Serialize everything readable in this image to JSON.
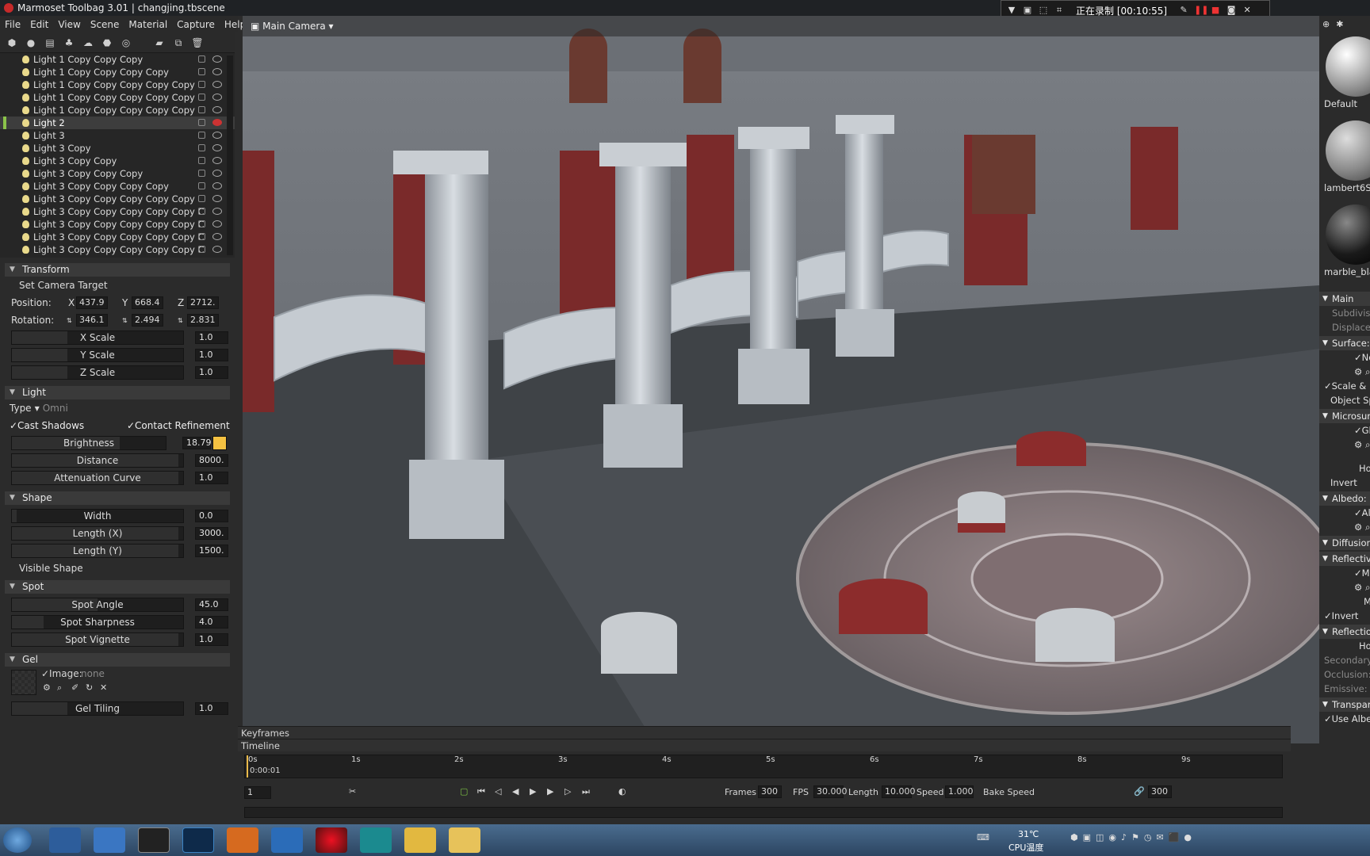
{
  "window": {
    "title": "Marmoset Toolbag 3.01  |  changjing.tbscene"
  },
  "recorder": {
    "status": "正在录制 [00:10:55]"
  },
  "menu": [
    "File",
    "Edit",
    "View",
    "Scene",
    "Material",
    "Capture",
    "Help"
  ],
  "toolbar_icons": [
    "cube-icon",
    "bulb-icon",
    "camera-icon",
    "tree-icon",
    "cloud-icon",
    "shape-icon",
    "sphere-icon",
    "folder-icon",
    "duplicate-icon",
    "trash-icon"
  ],
  "outliner": {
    "items": [
      "Light 1 Copy Copy Copy",
      "Light 1 Copy Copy Copy Copy",
      "Light 1 Copy Copy Copy Copy Copy",
      "Light 1 Copy Copy Copy Copy Copy",
      "Light 1 Copy Copy Copy Copy Copy",
      "Light 2",
      "Light 3",
      "Light 3 Copy",
      "Light 3 Copy Copy",
      "Light 3 Copy Copy Copy",
      "Light 3 Copy Copy Copy Copy",
      "Light 3 Copy Copy Copy Copy Copy",
      "Light 3 Copy Copy Copy Copy Copy C",
      "Light 3 Copy Copy Copy Copy Copy C",
      "Light 3 Copy Copy Copy Copy Copy C",
      "Light 3 Copy Copy Copy Copy Copy C"
    ],
    "selected_index": 5
  },
  "transform": {
    "title": "Transform",
    "set_camera_target": "Set Camera Target",
    "position_label": "Position:",
    "rotation_label": "Rotation:",
    "x_label": "X",
    "y_label": "Y",
    "z_label": "Z",
    "pos_x": "437.9",
    "pos_y": "668.4",
    "pos_z": "2712.",
    "rot_x": "346.1",
    "rot_y": "2.494",
    "rot_z": "2.831",
    "x_scale_label": "X Scale",
    "x_scale": "1.0",
    "y_scale_label": "Y Scale",
    "y_scale": "1.0",
    "z_scale_label": "Z Scale",
    "z_scale": "1.0"
  },
  "light": {
    "title": "Light",
    "type_label": "Type",
    "type_value": "Omni",
    "cast_shadows": "✓Cast Shadows",
    "contact_refinement": "✓Contact Refinement",
    "brightness_label": "Brightness",
    "brightness": "18.79",
    "distance_label": "Distance",
    "distance": "8000.",
    "attenuation_label": "Attenuation Curve",
    "attenuation": "1.0",
    "color": "#f5c242"
  },
  "shape": {
    "title": "Shape",
    "width_label": "Width",
    "width": "0.0",
    "length_x_label": "Length (X)",
    "length_x": "3000.",
    "length_y_label": "Length (Y)",
    "length_y": "1500.",
    "visible_shape": "Visible Shape"
  },
  "spot": {
    "title": "Spot",
    "angle_label": "Spot Angle",
    "angle": "45.0",
    "sharpness_label": "Spot Sharpness",
    "sharpness": "4.0",
    "vignette_label": "Spot Vignette",
    "vignette": "1.0"
  },
  "gel": {
    "title": "Gel",
    "image_label": "✓Image:",
    "image_value": "none",
    "tiling_label": "Gel Tiling",
    "tiling": "1.0"
  },
  "viewport": {
    "camera_label": "Main Camera ▾"
  },
  "materials": {
    "items": [
      "Default",
      "lambert6SG",
      "marble_bla..."
    ],
    "sections": [
      {
        "title": "Main",
        "collapsed": true
      },
      {
        "sub": "Subdivision:"
      },
      {
        "sub": "Displacement:"
      },
      {
        "title": "Surface:"
      },
      {
        "check": "✓Norma"
      },
      {
        "check": "✓Scale & Bias"
      },
      {
        "plain": "Object Space"
      },
      {
        "title": "Microsurface:"
      },
      {
        "check": "✓Gloss M"
      },
      {
        "plain": "Horizo"
      },
      {
        "plain": "Invert"
      },
      {
        "title": "Albedo:"
      },
      {
        "check": "✓Albedo"
      },
      {
        "title": "Diffusion:"
      },
      {
        "title": "Reflectivity:"
      },
      {
        "check": "✓Metaln"
      },
      {
        "plain": "M"
      },
      {
        "check": "✓Invert"
      },
      {
        "title": "Reflection:"
      },
      {
        "plain": "Horiz"
      },
      {
        "sub": "Secondary Refl"
      },
      {
        "sub": "Occlusion:"
      },
      {
        "sub": "Emissive:"
      },
      {
        "title": "Transparency:"
      },
      {
        "check": "✓Use Albedo Al"
      }
    ]
  },
  "timeline": {
    "keyframes_label": "Keyframes",
    "timeline_label": "Timeline",
    "ticks": [
      "0s",
      "1s",
      "2s",
      "3s",
      "4s",
      "5s",
      "6s",
      "7s",
      "8s",
      "9s"
    ],
    "current_time": "0:00:01",
    "current_frame": "1",
    "frames_label": "Frames",
    "frames": "300",
    "fps_label": "FPS",
    "fps": "30.000",
    "length_label": "Length",
    "length": "10.000",
    "speed_label": "Speed",
    "speed": "1.000",
    "bake_speed": "Bake Speed",
    "end_frame": "300"
  },
  "taskbar": {
    "temperature": "31℃",
    "cpu_label": "CPU温度",
    "apps": [
      "start-orb",
      "media-player",
      "internet-explorer",
      "marmoset",
      "photoshop",
      "firefox",
      "app-grid",
      "recorder",
      "maya",
      "notes",
      "explorer"
    ]
  }
}
